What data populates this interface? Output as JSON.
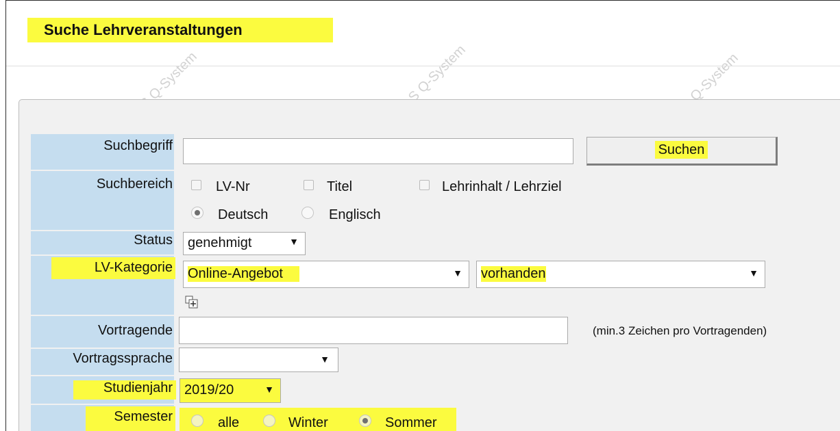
{
  "page": {
    "title": "Suche Lehrveranstaltungen",
    "watermark": "Q-System"
  },
  "form": {
    "suchbegriff": {
      "label": "Suchbegriff",
      "value": "",
      "button": "Suchen"
    },
    "suchbereich": {
      "label": "Suchbereich",
      "checkboxes": [
        "LV-Nr",
        "Titel",
        "Lehrinhalt / Lehrziel"
      ],
      "languages": [
        "Deutsch",
        "Englisch"
      ],
      "selected_language": "Deutsch"
    },
    "status": {
      "label": "Status",
      "value": "genehmigt"
    },
    "lv_kategorie": {
      "label": "LV-Kategorie",
      "value1": "Online-Angebot",
      "value2": "vorhanden"
    },
    "vortragende": {
      "label": "Vortragende",
      "value": "",
      "hint": "(min.3 Zeichen pro Vortragenden)"
    },
    "vortragssprache": {
      "label": "Vortragssprache",
      "value": ""
    },
    "studienjahr": {
      "label": "Studienjahr",
      "value": "2019/20"
    },
    "semester": {
      "label": "Semester",
      "options": [
        "alle",
        "Winter",
        "Sommer"
      ],
      "selected": "Sommer"
    }
  },
  "icons": {
    "dropdown": "triangle-down-icon",
    "add": "add-filter-icon"
  },
  "colors": {
    "highlight": "#fbfb3f",
    "label_bg": "#c5ddef",
    "panel_bg": "#f1f1f1"
  }
}
